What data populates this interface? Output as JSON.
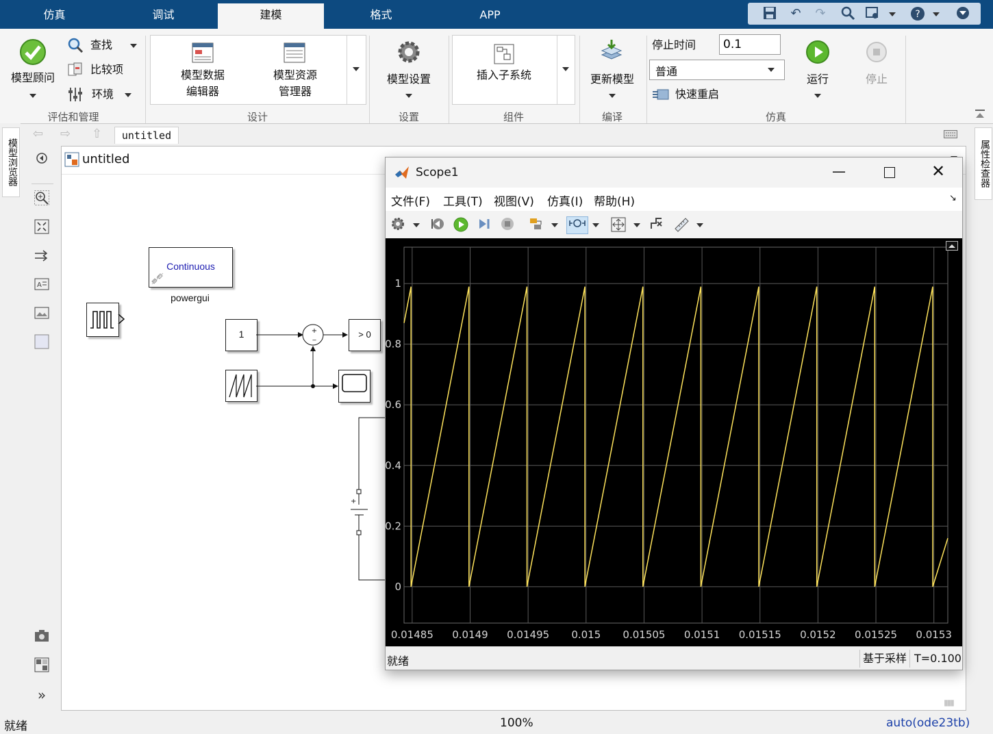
{
  "tabs": [
    {
      "label": "仿真",
      "active": false
    },
    {
      "label": "调试",
      "active": false
    },
    {
      "label": "建模",
      "active": true
    },
    {
      "label": "格式",
      "active": false
    },
    {
      "label": "APP",
      "active": false
    }
  ],
  "quick_access": [
    "save-icon",
    "undo-icon",
    "redo-icon",
    "search-icon",
    "layout-icon",
    "help-icon",
    "minimize-ribbon-icon"
  ],
  "ribbon": {
    "eval": {
      "advisor_label": "模型顾问",
      "find_label": "查找",
      "compare_label": "比较项",
      "env_label": "环境",
      "group_label": "评估和管理"
    },
    "design": {
      "data_editor_label": "模型数据\n编辑器",
      "explorer_label": "模型资源\n管理器",
      "group_label": "设计"
    },
    "setup": {
      "settings_label": "模型设置",
      "group_label": "设置"
    },
    "component": {
      "subsystem_label": "插入子系统",
      "group_label": "组件"
    },
    "compile": {
      "update_label": "更新模型",
      "group_label": "编译"
    },
    "simulation": {
      "stop_time_label": "停止时间",
      "stop_time_value": "0.1",
      "mode_value": "普通",
      "fast_restart_label": "快速重启",
      "run_label": "运行",
      "stop_label": "停止",
      "group_label": "仿真"
    }
  },
  "side": {
    "left_tab": "模型浏览器",
    "right_tab": "属性检查器"
  },
  "breadcrumb": {
    "model": "untitled"
  },
  "canvas": {
    "title": "untitled",
    "powergui_block": "Continuous",
    "powergui_label": "powergui",
    "constant_value": "1",
    "compare_label": "> 0",
    "sum_signs": "+\n_",
    "battery_plus": "+"
  },
  "status": {
    "left": "就绪",
    "zoom": "100%",
    "solver": "auto(ode23tb)"
  },
  "scope": {
    "title": "Scope1",
    "menu": [
      "文件(F)",
      "工具(T)",
      "视图(V)",
      "仿真(I)",
      "帮助(H)"
    ],
    "status_left": "就绪",
    "status_mode": "基于采样",
    "status_time": "T=0.100",
    "trace_color": "#ffe45c"
  },
  "chart_data": {
    "type": "line",
    "title": "",
    "xlabel": "",
    "ylabel": "",
    "xlim": [
      0.014843,
      0.015312
    ],
    "ylim": [
      -0.12,
      1.12
    ],
    "grid": true,
    "xticks": [
      0.01485,
      0.0149,
      0.01495,
      0.015,
      0.01505,
      0.0151,
      0.01515,
      0.0152,
      0.01525,
      0.0153
    ],
    "xtick_labels": [
      "0.01485",
      "0.0149",
      "0.01495",
      "0.015",
      "0.01505",
      "0.0151",
      "0.01515",
      "0.0152",
      "0.01525",
      "0.0153"
    ],
    "yticks": [
      0,
      0.2,
      0.4,
      0.6,
      0.8,
      1
    ],
    "ytick_labels": [
      "0",
      "0.2",
      "0.4",
      "0.6",
      "0.8",
      "1"
    ],
    "series": [
      {
        "color": "#ffe45c",
        "x": [
          0.014843,
          0.014849,
          0.014849,
          0.014899,
          0.014899,
          0.014949,
          0.014949,
          0.014999,
          0.014999,
          0.015049,
          0.015049,
          0.015099,
          0.015099,
          0.015149,
          0.015149,
          0.015199,
          0.015199,
          0.015249,
          0.015249,
          0.015299,
          0.015299,
          0.015312
        ],
        "y": [
          0.87,
          0.99,
          0,
          0.99,
          0,
          0.99,
          0,
          0.99,
          0,
          0.99,
          0,
          0.99,
          0,
          0.99,
          0,
          0.99,
          0,
          0.99,
          0,
          0.99,
          0,
          0.16
        ]
      }
    ]
  }
}
